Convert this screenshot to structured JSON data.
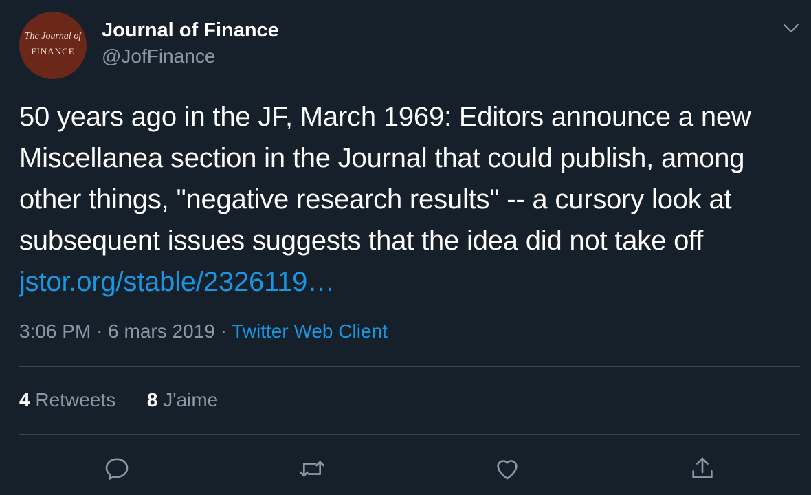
{
  "author": {
    "avatar_line1": "The Journal of",
    "avatar_line2": "FINANCE",
    "name": "Journal of Finance",
    "handle": "@JofFinance"
  },
  "tweet": {
    "text": "50 years ago in the JF, March 1969: Editors announce a new Miscellanea section in the Journal that could publish, among other things, \"negative research results\" -- a cursory look at subsequent issues suggests that the idea did not take off",
    "link_text": "jstor.org/stable/2326119…"
  },
  "meta": {
    "time": "3:06 PM",
    "separator": "·",
    "date": "6 mars 2019",
    "source": "Twitter Web Client"
  },
  "stats": {
    "retweets_count": "4",
    "retweets_label": "Retweets",
    "likes_count": "8",
    "likes_label": "J'aime"
  },
  "actions": {
    "reply_icon": "reply-icon",
    "retweet_icon": "retweet-icon",
    "like_icon": "heart-icon",
    "share_icon": "share-icon"
  },
  "colors": {
    "background": "#15202b",
    "text": "#ffffff",
    "secondary": "#8899a6",
    "link": "#1b95e0",
    "divider": "#38444d"
  }
}
